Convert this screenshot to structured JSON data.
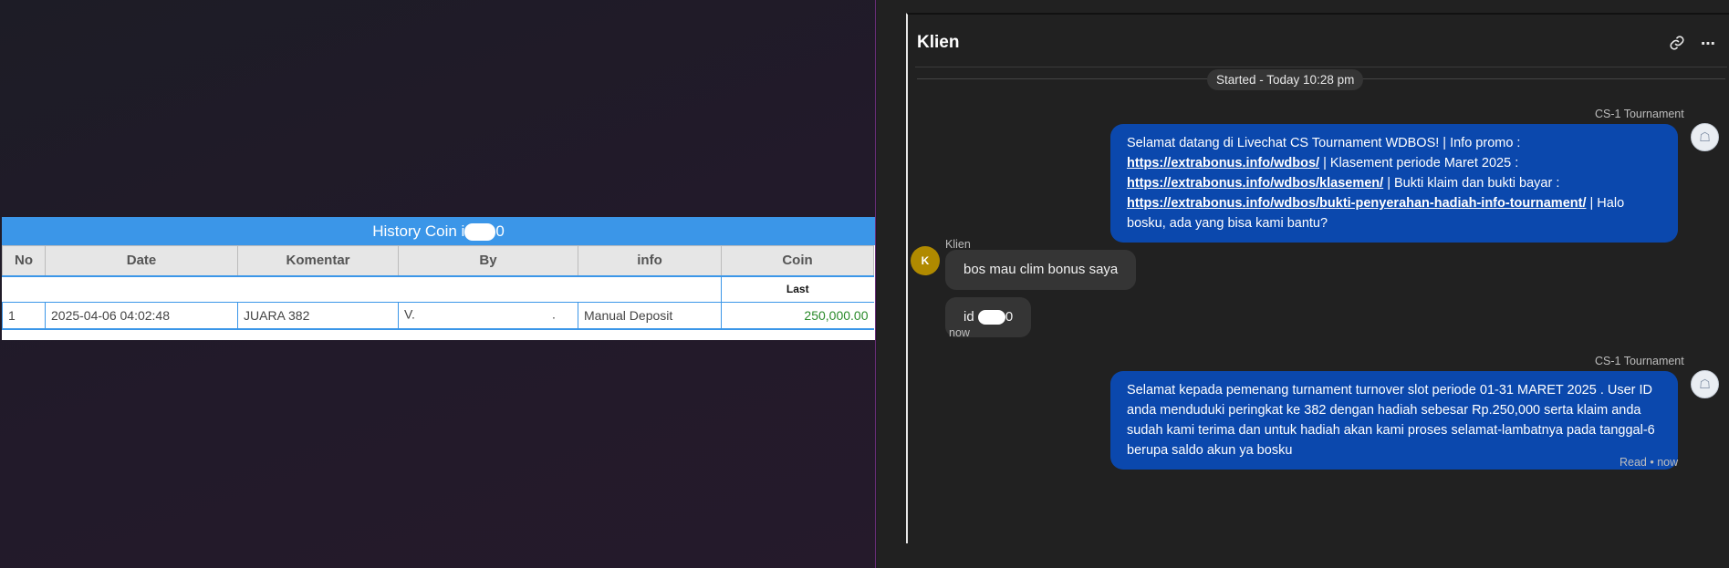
{
  "history": {
    "title_prefix": "History Coin i",
    "title_suffix": "0",
    "columns": [
      "No",
      "Date",
      "Komentar",
      "By",
      "info",
      "Coin"
    ],
    "sub_header": "Last",
    "rows": [
      {
        "no": "1",
        "date": "2025-04-06 04:02:48",
        "komentar": "JUARA 382",
        "by_start": "V.",
        "by_end": ".",
        "info": "Manual Deposit",
        "coin": "250,000.00"
      }
    ]
  },
  "chat": {
    "title": "Klien",
    "started": "Started - Today 10:28 pm",
    "messages": {
      "agent1": {
        "sender": "CS-1 Tournament",
        "t1": "Selamat datang di Livechat CS Tournament WDBOS! | Info promo :",
        "link1": "https://extrabonus.info/wdbos/",
        "t2": " | Klasement periode Maret 2025 :",
        "link2": "https://extrabonus.info/wdbos/klasemen/",
        "t3": " | Bukti klaim dan bukti bayar :",
        "link3": "https://extrabonus.info/wdbos/bukti-penyerahan-hadiah-info-tournament/",
        "t4": " | Halo bosku, ada yang bisa kami bantu?"
      },
      "client": {
        "sender": "Klien",
        "avatar_letter": "K",
        "msg1": "bos mau clim bonus saya",
        "msg2_prefix": "id ",
        "msg2_suffix": "0",
        "time": "now"
      },
      "agent2": {
        "sender": "CS-1 Tournament",
        "text": "Selamat kepada pemenang turnament turnover slot periode 01-31 MARET 2025 . User ID anda menduduki peringkat ke 382 dengan hadiah sebesar Rp.250,000 serta klaim anda sudah kami terima dan untuk hadiah akan kami proses selamat-lambatnya pada tanggal-6 berupa saldo akun ya bosku",
        "status": "Read • now"
      }
    },
    "icons": {
      "link": "link-icon",
      "more": "more-options-icon",
      "avatar": "agent-avatar-icon"
    }
  }
}
